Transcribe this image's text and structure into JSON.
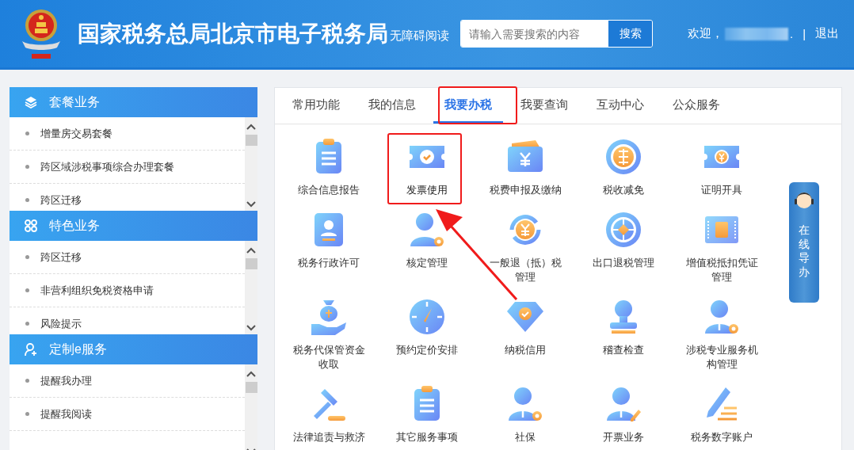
{
  "header": {
    "title": "国家税务总局北京市电子税务局",
    "accessibility_link": "无障碍阅读",
    "search": {
      "placeholder": "请输入需要搜索的内容",
      "button": "搜索"
    },
    "welcome": "欢迎，",
    "user_suffix": ".",
    "separator": "|",
    "logout": "退出"
  },
  "sidebar": {
    "sections": [
      {
        "title": "套餐业务",
        "items": [
          {
            "label": "增量房交易套餐"
          },
          {
            "label": "跨区域涉税事项综合办理套餐"
          },
          {
            "label": "跨区迁移"
          }
        ]
      },
      {
        "title": "特色业务",
        "items": [
          {
            "label": "跨区迁移"
          },
          {
            "label": "非营利组织免税资格申请"
          },
          {
            "label": "风险提示"
          }
        ]
      },
      {
        "title": "定制e服务",
        "items": [
          {
            "label": "提醒我办理"
          },
          {
            "label": "提醒我阅读"
          }
        ]
      }
    ]
  },
  "tabs": [
    {
      "label": "常用功能",
      "selected": false
    },
    {
      "label": "我的信息",
      "selected": false
    },
    {
      "label": "我要办税",
      "selected": true
    },
    {
      "label": "我要查询",
      "selected": false
    },
    {
      "label": "互动中心",
      "selected": false
    },
    {
      "label": "公众服务",
      "selected": false
    }
  ],
  "services": [
    {
      "label": "综合信息报告",
      "highlighted": false
    },
    {
      "label": "发票使用",
      "highlighted": true
    },
    {
      "label": "税费申报及缴纳",
      "highlighted": false
    },
    {
      "label": "税收减免",
      "highlighted": false
    },
    {
      "label": "证明开具",
      "highlighted": false
    },
    {
      "label": "税务行政许可",
      "highlighted": false
    },
    {
      "label": "核定管理",
      "highlighted": false
    },
    {
      "label": "一般退（抵）税管理",
      "highlighted": false
    },
    {
      "label": "出口退税管理",
      "highlighted": false
    },
    {
      "label": "增值税抵扣凭证管理",
      "highlighted": false
    },
    {
      "label": "税务代保管资金收取",
      "highlighted": false
    },
    {
      "label": "预约定价安排",
      "highlighted": false
    },
    {
      "label": "纳税信用",
      "highlighted": false
    },
    {
      "label": "稽查检查",
      "highlighted": false
    },
    {
      "label": "涉税专业服务机构管理",
      "highlighted": false
    },
    {
      "label": "法律追责与救济",
      "highlighted": false
    },
    {
      "label": "其它服务事项",
      "highlighted": false
    },
    {
      "label": "社保",
      "highlighted": false
    },
    {
      "label": "开票业务",
      "highlighted": false
    },
    {
      "label": "税务数字账户",
      "highlighted": false
    }
  ],
  "online_guide": {
    "label": "在线导办"
  }
}
